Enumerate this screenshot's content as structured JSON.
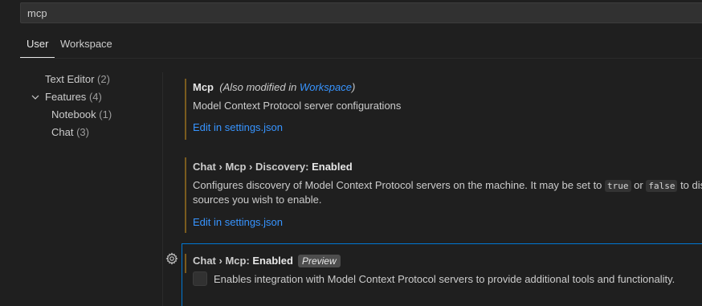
{
  "search": {
    "value": "mcp"
  },
  "tabs": [
    {
      "label": "User",
      "active": true
    },
    {
      "label": "Workspace",
      "active": false
    }
  ],
  "toc": [
    {
      "label": "Text Editor",
      "count": "(2)"
    },
    {
      "label": "Features",
      "count": "(4)",
      "expanded": true
    },
    {
      "label": "Notebook",
      "count": "(1)"
    },
    {
      "label": "Chat",
      "count": "(3)"
    }
  ],
  "settings": {
    "mcp": {
      "title": "Mcp",
      "modified_prefix": "(Also modified in ",
      "modified_link": "Workspace",
      "modified_suffix": ")",
      "description": "Model Context Protocol server configurations",
      "edit_link": "Edit in settings.json"
    },
    "discovery": {
      "category": "Chat › Mcp › Discovery: ",
      "name": "Enabled",
      "desc_part1": "Configures discovery of Model Context Protocol servers on the machine. It may be set to ",
      "code_true": "true",
      "desc_or": " or ",
      "code_false": "false",
      "desc_part2": " to disa",
      "desc_line2": "sources you wish to enable.",
      "edit_link": "Edit in settings.json"
    },
    "enabled": {
      "category": "Chat › Mcp: ",
      "name": "Enabled",
      "badge": "Preview",
      "description": "Enables integration with Model Context Protocol servers to provide additional tools and functionality.",
      "checked": false
    }
  },
  "colors": {
    "accent": "#3794ff",
    "focus_border": "#0078d4",
    "modified_bar": "#7a5b1e"
  }
}
